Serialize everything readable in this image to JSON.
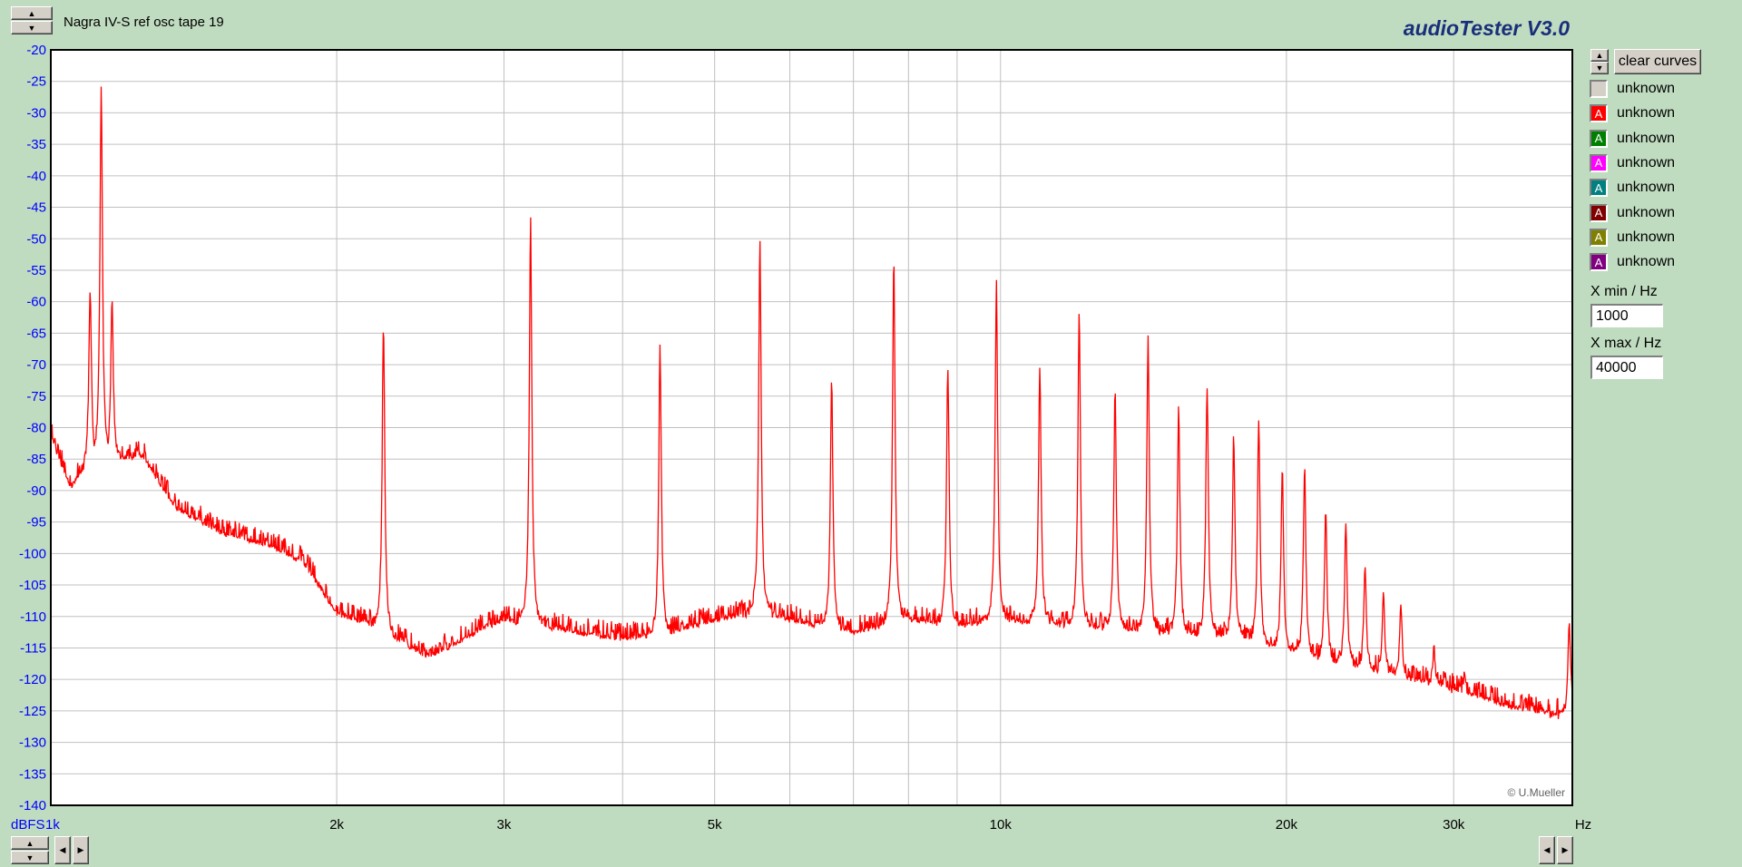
{
  "header": {
    "title": "Nagra IV-S ref osc tape 19",
    "brand": "audioTester  V3.0"
  },
  "controls": {
    "clear_label": "clear curves",
    "xmin_label": "X min / Hz",
    "xmin_value": "1000",
    "xmax_label": "X max / Hz",
    "xmax_value": "40000",
    "arrow_up": "▲",
    "arrow_down": "▼",
    "arrow_left": "◀",
    "arrow_right": "▶"
  },
  "legend": [
    {
      "label": "unknown",
      "color": "#d4d0c8",
      "mark": ""
    },
    {
      "label": "unknown",
      "color": "#ff0000",
      "mark": "A"
    },
    {
      "label": "unknown",
      "color": "#008000",
      "mark": "A"
    },
    {
      "label": "unknown",
      "color": "#ff00ff",
      "mark": "A"
    },
    {
      "label": "unknown",
      "color": "#008080",
      "mark": "A"
    },
    {
      "label": "unknown",
      "color": "#800000",
      "mark": "A"
    },
    {
      "label": "unknown",
      "color": "#808000",
      "mark": "A"
    },
    {
      "label": "unknown",
      "color": "#800080",
      "mark": "A"
    }
  ],
  "chart_data": {
    "type": "line",
    "title": "",
    "xlabel": "Hz",
    "ylabel": "dBFS",
    "x_scale": "log",
    "xlim": [
      1000,
      40000
    ],
    "ylim": [
      -140,
      -20
    ],
    "grid": true,
    "x_major_ticks": [
      {
        "v": 1000,
        "label": "1k"
      },
      {
        "v": 2000,
        "label": "2k"
      },
      {
        "v": 3000,
        "label": "3k"
      },
      {
        "v": 5000,
        "label": "5k"
      },
      {
        "v": 10000,
        "label": "10k"
      },
      {
        "v": 20000,
        "label": "20k"
      },
      {
        "v": 30000,
        "label": "30k"
      },
      {
        "v": 40000,
        "label": "Hz"
      }
    ],
    "x_minor_grid": [
      4000,
      6000,
      7000,
      8000,
      9000
    ],
    "y_ticks": [
      -20,
      -25,
      -30,
      -35,
      -40,
      -45,
      -50,
      -55,
      -60,
      -65,
      -70,
      -75,
      -80,
      -85,
      -90,
      -95,
      -100,
      -105,
      -110,
      -115,
      -120,
      -125,
      -130,
      -135,
      -140
    ],
    "y_tick_labels": [
      "-20",
      "-25",
      "-30",
      "-35",
      "-40",
      "-45",
      "-50",
      "-55",
      "-60",
      "-65",
      "-70",
      "-75",
      "-80",
      "-85",
      "-90",
      "-95",
      "-100",
      "-105",
      "-110",
      "-115",
      "-120",
      "-125",
      "-130",
      "-135",
      "-140"
    ],
    "corner_label": "dBFS",
    "watermark": "© U.Mueller",
    "colors": {
      "plot_bg": "#ffffff",
      "grid": "#c0c0c0",
      "axis_text": "#0000ff",
      "trace": "#ff0000"
    },
    "series": [
      {
        "color": "#ff0000",
        "noise_floor": [
          [
            1000,
            -82
          ],
          [
            1050,
            -90
          ],
          [
            1100,
            -86
          ],
          [
            1250,
            -85
          ],
          [
            1350,
            -93
          ],
          [
            1500,
            -97
          ],
          [
            1700,
            -99
          ],
          [
            1850,
            -102
          ],
          [
            2000,
            -110
          ],
          [
            2200,
            -112
          ],
          [
            2500,
            -117
          ],
          [
            2800,
            -113
          ],
          [
            3000,
            -111
          ],
          [
            3300,
            -112
          ],
          [
            3600,
            -113
          ],
          [
            4000,
            -114
          ],
          [
            4500,
            -113
          ],
          [
            5000,
            -111
          ],
          [
            5500,
            -110
          ],
          [
            6000,
            -111
          ],
          [
            7000,
            -113
          ],
          [
            8000,
            -111
          ],
          [
            9000,
            -112
          ],
          [
            10000,
            -111
          ],
          [
            12000,
            -112
          ],
          [
            15000,
            -113
          ],
          [
            18000,
            -114
          ],
          [
            20000,
            -116
          ],
          [
            25000,
            -119
          ],
          [
            30000,
            -122
          ],
          [
            35000,
            -125
          ],
          [
            39000,
            -126
          ],
          [
            40000,
            -125
          ]
        ],
        "peaks": [
          [
            1130,
            -26
          ],
          [
            1100,
            -58
          ],
          [
            1160,
            -60
          ],
          [
            2240,
            -63
          ],
          [
            3200,
            -47
          ],
          [
            4380,
            -67
          ],
          [
            5580,
            -50
          ],
          [
            6640,
            -72
          ],
          [
            7720,
            -53
          ],
          [
            8800,
            -70
          ],
          [
            9900,
            -57
          ],
          [
            11000,
            -70
          ],
          [
            12100,
            -62
          ],
          [
            13200,
            -74
          ],
          [
            14300,
            -66
          ],
          [
            15400,
            -77
          ],
          [
            16500,
            -73
          ],
          [
            17600,
            -81
          ],
          [
            18700,
            -79
          ],
          [
            19800,
            -86
          ],
          [
            20900,
            -86
          ],
          [
            22000,
            -93
          ],
          [
            23100,
            -95
          ],
          [
            24200,
            -102
          ],
          [
            25300,
            -106
          ],
          [
            26400,
            -108
          ],
          [
            28600,
            -115
          ],
          [
            30800,
            -119
          ],
          [
            39700,
            -111
          ]
        ]
      }
    ]
  }
}
